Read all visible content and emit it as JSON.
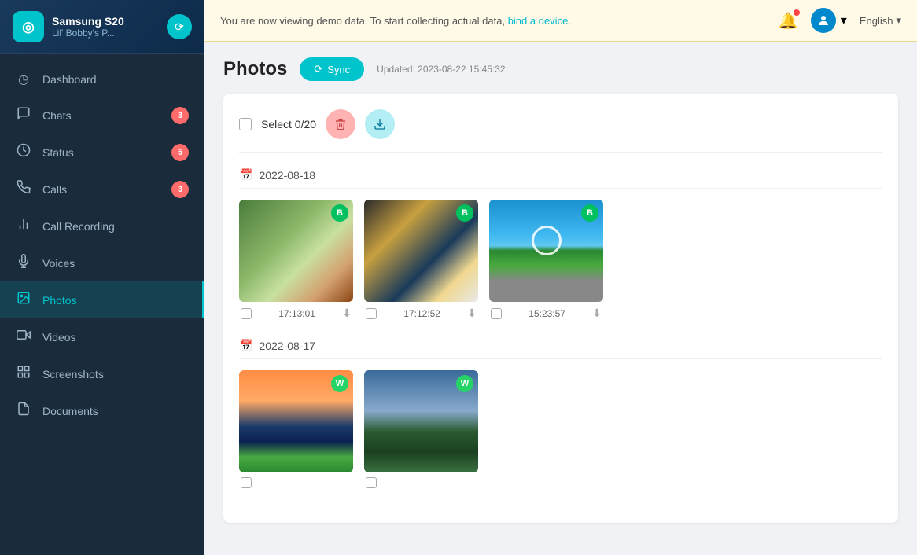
{
  "app": {
    "logo": "◎",
    "device_name": "Samsung S20",
    "device_sub": "Lil' Bobby's P...",
    "sync_icon": "⟳"
  },
  "topbar": {
    "demo_text": "You are now viewing demo data. To start collecting actual data,",
    "demo_link": "bind a device.",
    "language": "English"
  },
  "sidebar": {
    "items": [
      {
        "id": "dashboard",
        "label": "Dashboard",
        "icon": "◷",
        "badge": null
      },
      {
        "id": "chats",
        "label": "Chats",
        "icon": "💬",
        "badge": "3"
      },
      {
        "id": "status",
        "label": "Status",
        "icon": "⏱",
        "badge": "5"
      },
      {
        "id": "calls",
        "label": "Calls",
        "icon": "📞",
        "badge": "3"
      },
      {
        "id": "call-recording",
        "label": "Call Recording",
        "icon": "📊",
        "badge": null
      },
      {
        "id": "voices",
        "label": "Voices",
        "icon": "🎙",
        "badge": null
      },
      {
        "id": "photos",
        "label": "Photos",
        "icon": "🖼",
        "badge": null,
        "active": true
      },
      {
        "id": "videos",
        "label": "Videos",
        "icon": "🎬",
        "badge": null
      },
      {
        "id": "screenshots",
        "label": "Screenshots",
        "icon": "⊞",
        "badge": null
      },
      {
        "id": "documents",
        "label": "Documents",
        "icon": "📄",
        "badge": null
      }
    ]
  },
  "page": {
    "title": "Photos",
    "sync_label": "Sync",
    "updated_label": "Updated: 2023-08-22 15:45:32",
    "select_label": "Select  0/20"
  },
  "date_sections": [
    {
      "date": "2022-08-18",
      "photos": [
        {
          "time": "17:13:01",
          "badge": "B",
          "type": "food"
        },
        {
          "time": "17:12:52",
          "badge": "B",
          "type": "room"
        },
        {
          "time": "15:23:57",
          "badge": "B",
          "type": "park"
        }
      ]
    },
    {
      "date": "2022-08-17",
      "photos": [
        {
          "time": "",
          "badge": "W",
          "type": "sky"
        },
        {
          "time": "",
          "badge": "W",
          "type": "trees"
        }
      ]
    }
  ]
}
